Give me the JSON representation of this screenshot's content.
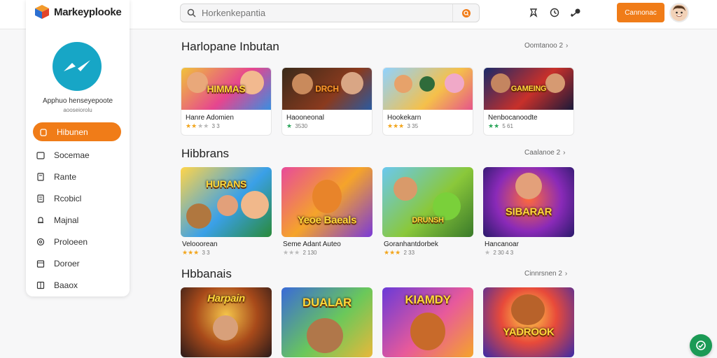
{
  "header": {
    "brand": "Markeyplooke",
    "search_placeholder": "Horkenkepantia",
    "cta_label": "Cannonac",
    "icons": [
      "pin-icon",
      "clock-icon",
      "key-icon"
    ]
  },
  "sidebar": {
    "profile_name": "Apphuo henseyepoote",
    "profile_sub": "aooseiorolu",
    "items": [
      {
        "label": "Hibunen",
        "icon": "home-icon",
        "active": true
      },
      {
        "label": "Socemae",
        "icon": "folder-icon"
      },
      {
        "label": "Rante",
        "icon": "document-icon"
      },
      {
        "label": "Rcobicl",
        "icon": "list-icon"
      },
      {
        "label": "Majnal",
        "icon": "bell-icon"
      },
      {
        "label": "Proloeen",
        "icon": "shield-icon"
      },
      {
        "label": "Doroer",
        "icon": "calendar-icon"
      },
      {
        "label": "Baaox",
        "icon": "grid-icon"
      }
    ]
  },
  "colors": {
    "accent": "#f07c18",
    "brand_circle": "#17a6c6",
    "fab": "#1b9a55",
    "star": "#f2a51c"
  },
  "sections": [
    {
      "title": "Harlopane Inbutan",
      "see_all": "Oomtanoo 2",
      "cards": [
        {
          "name": "Hanre Adomien",
          "rating": "3 3",
          "stars": 2,
          "thumb_text": "HIMMAS"
        },
        {
          "name": "Haooneonal",
          "rating": "3530",
          "stars": 1,
          "thumb_text": "DRCH"
        },
        {
          "name": "Hookekarn",
          "rating": "3 35",
          "stars": 3,
          "thumb_text": ""
        },
        {
          "name": "Nenbocanoodte",
          "rating": "5 61",
          "stars": 2,
          "thumb_text": "GAMEING"
        }
      ]
    },
    {
      "title": "Hibbrans",
      "see_all": "Caalanoe 2",
      "cards": [
        {
          "name": "Velooorean",
          "rating": "3 3",
          "stars": 3,
          "thumb_text": "HURANS"
        },
        {
          "name": "Seme Adant Auteo",
          "rating": "2 130",
          "stars": 0,
          "thumb_text": "Yeoe Baeals"
        },
        {
          "name": "Goranhantdorbek",
          "rating": "2 33",
          "stars": 3,
          "thumb_text": "DRUNSH"
        },
        {
          "name": "Hancanoar",
          "rating": "2 30 4 3",
          "stars": 0,
          "thumb_text": "SIBARAR"
        }
      ]
    },
    {
      "title": "Hbbanais",
      "see_all": "Cinnrsnen 2",
      "cards": [
        {
          "name": "",
          "rating": "",
          "stars": 0,
          "thumb_text": "Harpain"
        },
        {
          "name": "",
          "rating": "",
          "stars": 0,
          "thumb_text": "DUALAR"
        },
        {
          "name": "",
          "rating": "",
          "stars": 0,
          "thumb_text": "KIAMDY"
        },
        {
          "name": "",
          "rating": "",
          "stars": 0,
          "thumb_text": "YADROOK"
        }
      ]
    }
  ]
}
